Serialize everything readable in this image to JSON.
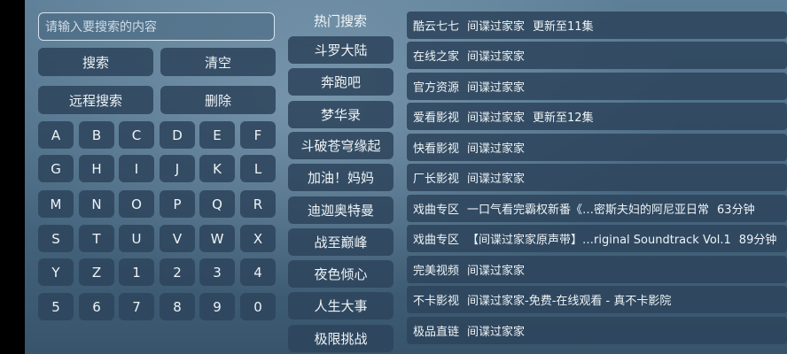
{
  "search": {
    "placeholder": "请输入要搜索的内容",
    "search_label": "搜索",
    "clear_label": "清空",
    "remote_label": "远程搜索",
    "delete_label": "删除"
  },
  "keyboard": {
    "rows": [
      [
        "A",
        "B",
        "C",
        "D",
        "E",
        "F"
      ],
      [
        "G",
        "H",
        "I",
        "J",
        "K",
        "L"
      ],
      [
        "M",
        "N",
        "O",
        "P",
        "Q",
        "R"
      ],
      [
        "S",
        "T",
        "U",
        "V",
        "W",
        "X"
      ],
      [
        "Y",
        "Z",
        "1",
        "2",
        "3",
        "4"
      ],
      [
        "5",
        "6",
        "7",
        "8",
        "9",
        "0"
      ]
    ]
  },
  "hot": {
    "title": "热门搜索",
    "items": [
      "斗罗大陆",
      "奔跑吧",
      "梦华录",
      "斗破苍穹缘起",
      "加油！妈妈",
      "迪迦奥特曼",
      "战至巅峰",
      "夜色倾心",
      "人生大事",
      "极限挑战"
    ]
  },
  "results": [
    {
      "source": "酷云七七",
      "title": "间谍过家家",
      "extra": "更新至11集"
    },
    {
      "source": "在线之家",
      "title": "间谍过家家",
      "extra": ""
    },
    {
      "source": "官方资源",
      "title": "间谍过家家",
      "extra": ""
    },
    {
      "source": "爱看影视",
      "title": "间谍过家家",
      "extra": "更新至12集"
    },
    {
      "source": "快看影视",
      "title": "间谍过家家",
      "extra": ""
    },
    {
      "source": "厂长影视",
      "title": "间谍过家家",
      "extra": ""
    },
    {
      "source": "戏曲专区",
      "title": "一口气看完霸权新番《…密斯夫妇的阿尼亚日常",
      "extra": "63分钟"
    },
    {
      "source": "戏曲专区",
      "title": "【间谍过家家原声带】…riginal Soundtrack Vol.1",
      "extra": "89分钟"
    },
    {
      "source": "完美视频",
      "title": "间谍过家家",
      "extra": ""
    },
    {
      "source": "不卡影视",
      "title": "间谍过家家-免费-在线观看 - 真不卡影院",
      "extra": ""
    },
    {
      "source": "极品直链",
      "title": "间谍过家家",
      "extra": ""
    }
  ]
}
